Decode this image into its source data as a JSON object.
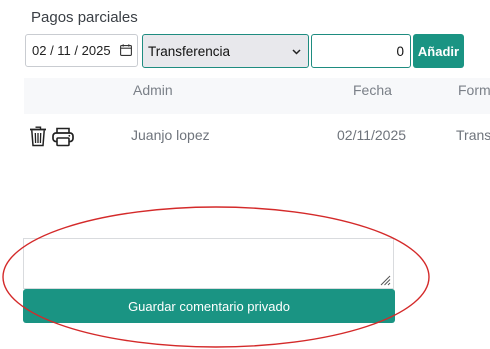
{
  "section_title": "Pagos parciales",
  "form": {
    "date_value": "02 / 11 / 2025",
    "method_value": "Transferencia",
    "amount_value": "0",
    "add_label": "Añadir"
  },
  "table": {
    "headers": [
      "Admin",
      "Fecha",
      "Form"
    ],
    "rows": [
      {
        "admin": "Juanjo lopez",
        "fecha": "02/11/2025",
        "forma": "Trans"
      }
    ]
  },
  "comment": {
    "value": "",
    "save_label": "Guardar comentario privado"
  },
  "colors": {
    "accent": "#1a9483",
    "annotation": "#d42a2a"
  }
}
